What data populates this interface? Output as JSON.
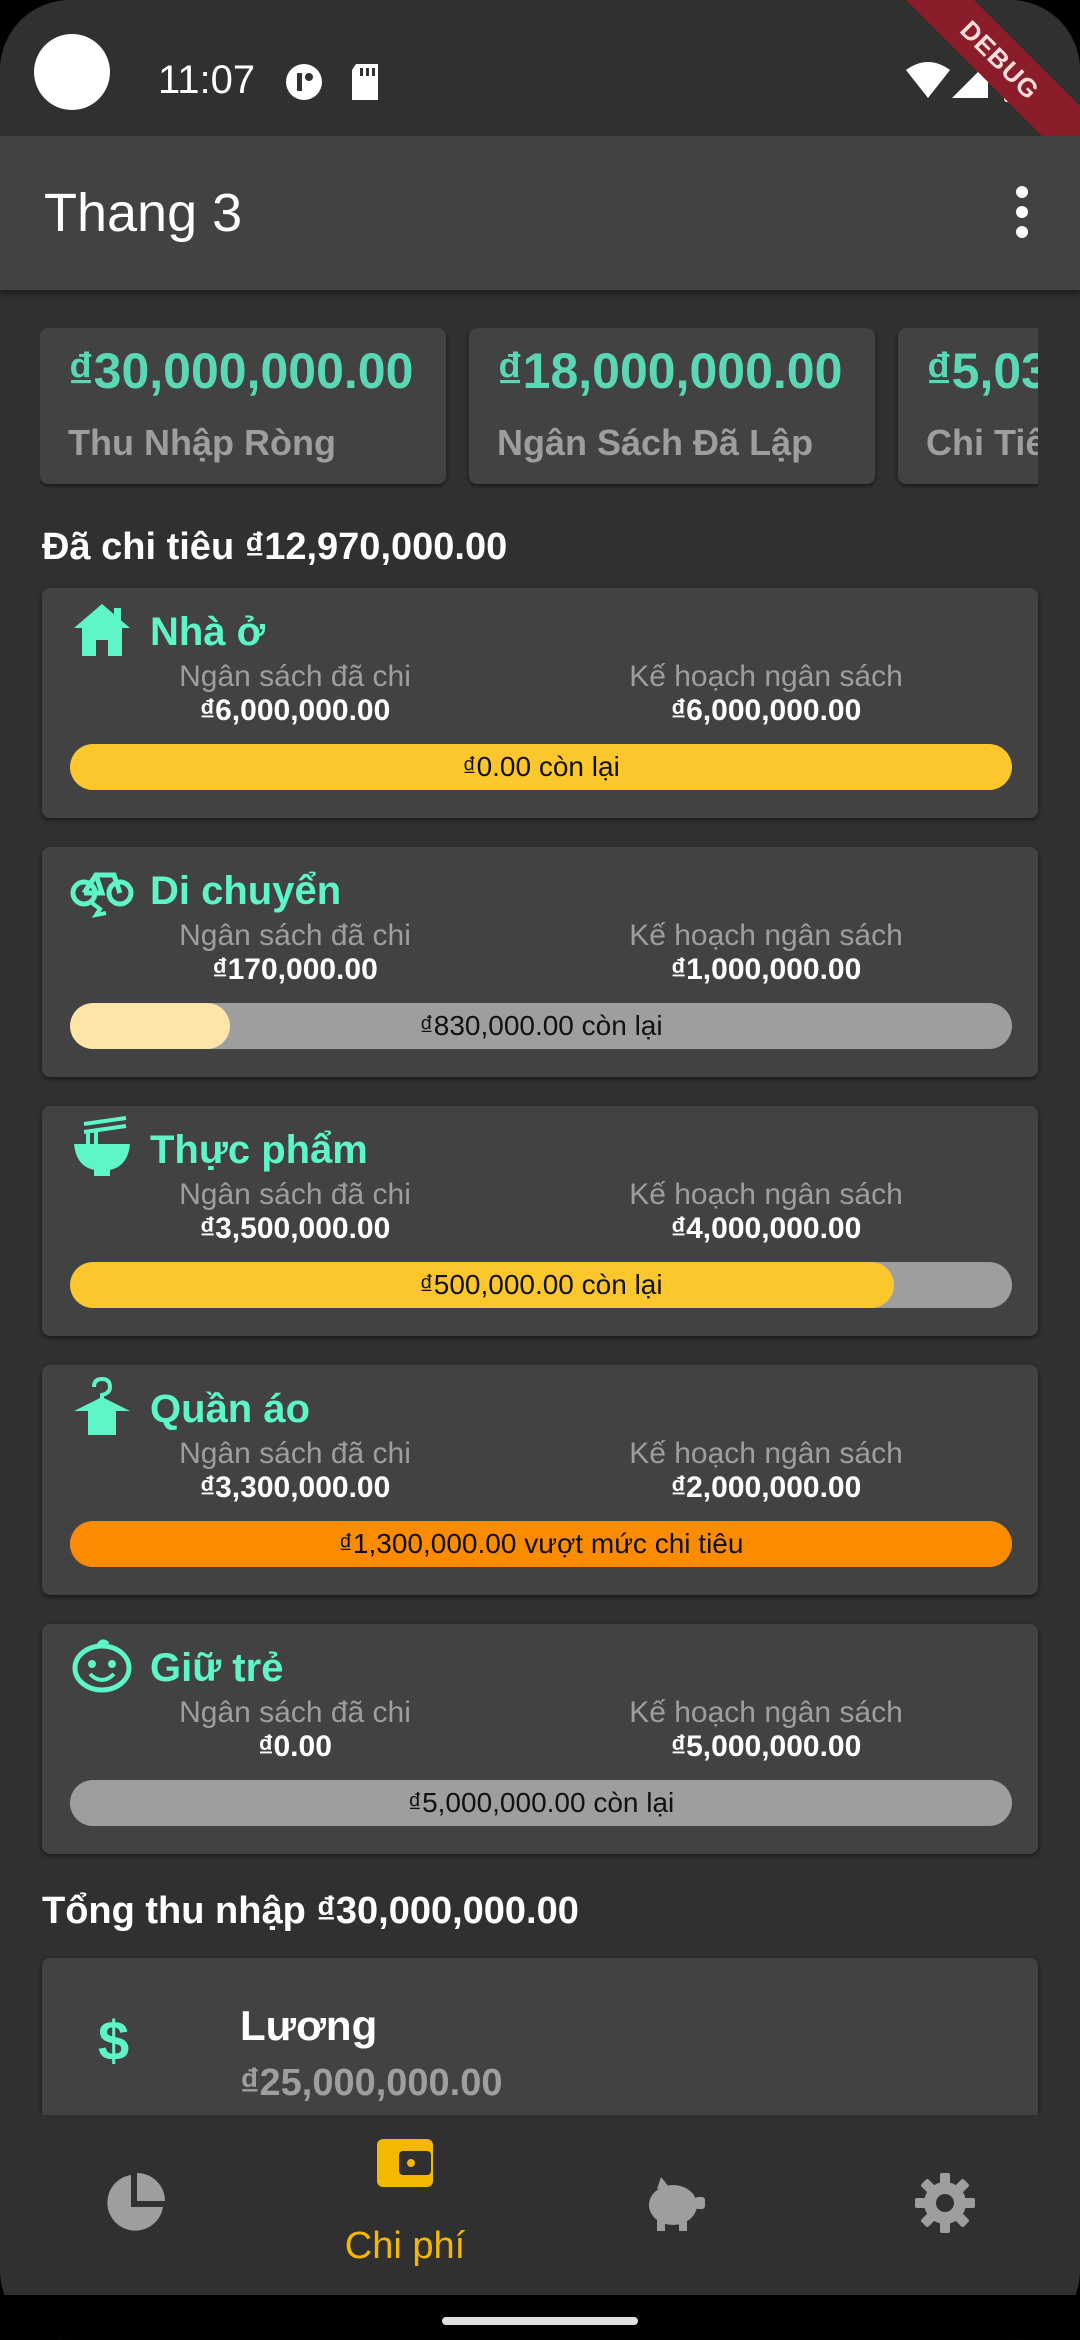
{
  "status_bar": {
    "time": "11:07",
    "debug_label": "DEBUG"
  },
  "app_bar": {
    "title": "Thang 3"
  },
  "summary_cards": [
    {
      "amount": "₫30,000,000.00",
      "label": "Thu Nhập Ròng"
    },
    {
      "amount": "₫18,000,000.00",
      "label": "Ngân Sách Đã Lập"
    },
    {
      "amount": "₫5,03",
      "label": "Chi Tiê"
    }
  ],
  "spent_heading": "Đã chi tiêu ₫12,970,000.00",
  "categories": [
    {
      "name": "Nhà ở",
      "icon": "house-icon",
      "spent_label": "Ngân sách đã chi",
      "spent": "₫6,000,000.00",
      "plan_label": "Kế hoạch ngân sách",
      "plan": "₫6,000,000.00",
      "remaining_text": "₫0.00 còn lại",
      "progress": 1.0,
      "bar_color": "#fbc72c"
    },
    {
      "name": "Di chuyển",
      "icon": "bicycle-icon",
      "spent_label": "Ngân sách đã chi",
      "spent": "₫170,000.00",
      "plan_label": "Kế hoạch ngân sách",
      "plan": "₫1,000,000.00",
      "remaining_text": "₫830,000.00 còn lại",
      "progress": 0.17,
      "bar_color": "#ffe4a8"
    },
    {
      "name": "Thực phẩm",
      "icon": "noodle-bowl-icon",
      "spent_label": "Ngân sách đã chi",
      "spent": "₫3,500,000.00",
      "plan_label": "Kế hoạch ngân sách",
      "plan": "₫4,000,000.00",
      "remaining_text": "₫500,000.00 còn lại",
      "progress": 0.875,
      "bar_color": "#fbc72c"
    },
    {
      "name": "Quần áo",
      "icon": "hanger-icon",
      "spent_label": "Ngân sách đã chi",
      "spent": "₫3,300,000.00",
      "plan_label": "Kế hoạch ngân sách",
      "plan": "₫2,000,000.00",
      "remaining_text": "₫1,300,000.00 vượt mức chi tiêu",
      "progress": 1.0,
      "bar_color": "#fb8c00"
    },
    {
      "name": "Giữ trẻ",
      "icon": "baby-face-icon",
      "spent_label": "Ngân sách đã chi",
      "spent": "₫0.00",
      "plan_label": "Kế hoạch ngân sách",
      "plan": "₫5,000,000.00",
      "remaining_text": "₫5,000,000.00 còn lại",
      "progress": 0.0,
      "bar_color": "#fbc72c"
    }
  ],
  "income_heading": "Tổng thu nhập ₫30,000,000.00",
  "income_items": [
    {
      "icon": "dollar-icon",
      "symbol": "$",
      "name": "Lương",
      "amount": "₫25,000,000.00"
    }
  ],
  "bottom_nav": {
    "items": [
      {
        "icon": "pie-chart-icon",
        "label": ""
      },
      {
        "icon": "wallet-icon",
        "label": "Chi phí",
        "active": true
      },
      {
        "icon": "piggy-bank-icon",
        "label": ""
      },
      {
        "icon": "gear-icon",
        "label": ""
      }
    ]
  },
  "colors": {
    "accent": "#5ef5c8",
    "active_nav": "#f5b800",
    "card": "#424242",
    "background": "#303030"
  }
}
